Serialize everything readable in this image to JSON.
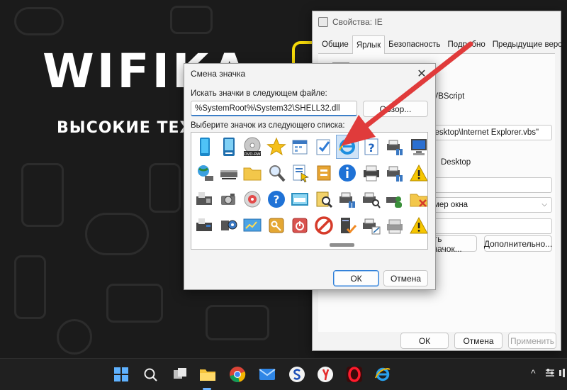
{
  "wallpaper": {
    "logo": "WIFIKA",
    "tagline": "ВЫСОКИЕ ТЕХН"
  },
  "props_window": {
    "title": "Свойства: IE",
    "tabs": [
      {
        "label": "Общие"
      },
      {
        "label": "Ярлык"
      },
      {
        "label": "Безопасность"
      },
      {
        "label": "Подробно"
      },
      {
        "label": "Предыдущие версии"
      }
    ],
    "type_fragment": "а VBScript",
    "target_fragment": "\\Desktop\\Internet Explorer.vbs\"",
    "workdir_fragment": "Desktop",
    "window_fragment": "мер окна",
    "change_icon_button": "ить значок...",
    "advanced_button": "Дополнительно...",
    "ok_button": "ОК",
    "cancel_button": "Отмена",
    "apply_button": "Применить"
  },
  "icon_dialog": {
    "title": "Смена значка",
    "file_label": "Искать значки в следующем файле:",
    "file_path": "%SystemRoot%\\System32\\SHELL32.dll",
    "browse_button": "Обзор...",
    "list_label": "Выберите значок из следующего списка:",
    "dvd_icon_text": "DVD-RW",
    "ok_button": "ОК",
    "cancel_button": "Отмена",
    "close_glyph": "✕"
  },
  "taskbar": {
    "apps": [
      "windows-start",
      "search",
      "task-view",
      "file-explorer",
      "chrome",
      "mail",
      "app-s",
      "yandex",
      "opera",
      "edge"
    ],
    "tray_chevron": "^"
  },
  "colors": {
    "accent": "#2f7fd8",
    "annotation_arrow": "#e03b3b",
    "selection": "#cfe3f7",
    "taskbar": "#202020"
  }
}
